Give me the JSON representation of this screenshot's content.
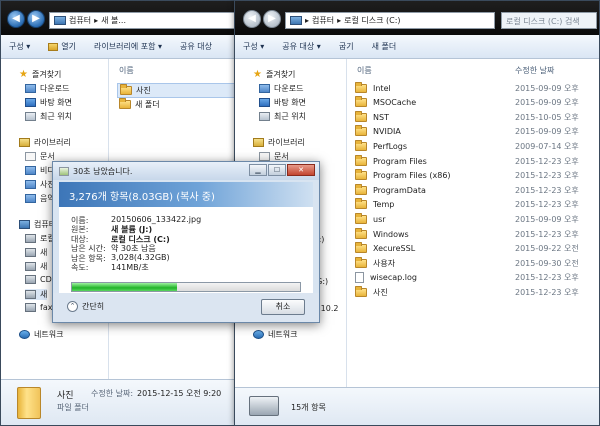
{
  "left_window": {
    "address": [
      "컴퓨터",
      "새 볼..."
    ],
    "toolbar": {
      "organize": "구성 ▾",
      "open": "열기",
      "include_library": "라이브러리에 포함 ▾",
      "share": "공유 대상"
    },
    "nav": {
      "favorites": "즐겨찾기",
      "downloads": "다운로드",
      "desktop": "바탕 화면",
      "recent": "최근 위치",
      "libraries": "라이브러리",
      "lib_docs": "문서",
      "lib_video": "비디",
      "lib_pictures": "사진",
      "lib_music": "음악",
      "computer": "컴퓨터",
      "drive_local": "로컬",
      "drive_new1": "새",
      "drive_new2": "새",
      "drive_cd": "CD",
      "drive_new3": "새",
      "drive_fax": "fax(",
      "network": "네트워크"
    },
    "column_name": "이름",
    "items": [
      "사진",
      "새 폴더"
    ],
    "details": {
      "name": "사진",
      "date_label": "수정한 날짜:",
      "date_value": "2015-12-15 오전 9:20",
      "type": "파일 폴더"
    }
  },
  "right_window": {
    "address": [
      "컴퓨터",
      "로컬 디스크 (C:)"
    ],
    "search_placeholder": "로컬 디스크 (C:) 검색",
    "toolbar": {
      "organize": "구성 ▾",
      "share": "공유 대상 ▾",
      "burn": "굽기",
      "new_folder": "새 폴더"
    },
    "nav": {
      "favorites": "즐겨찾기",
      "downloads": "다운로드",
      "desktop": "바탕 화면",
      "recent": "최근 위치",
      "libraries": "라이브러리",
      "lib_docs": "문서",
      "drive_c": "C:)",
      "drive_g": "(G:)",
      "net_ip": "8.10.2",
      "network": "네트워크"
    },
    "columns": {
      "name": "이름",
      "date": "수정한 날짜"
    },
    "rows": [
      {
        "name": "Intel",
        "date": "2015-09-09 오후",
        "type": "folder"
      },
      {
        "name": "MSOCache",
        "date": "2015-09-09 오후",
        "type": "folder"
      },
      {
        "name": "NST",
        "date": "2015-10-05 오후",
        "type": "folder"
      },
      {
        "name": "NVIDIA",
        "date": "2015-09-09 오후",
        "type": "folder"
      },
      {
        "name": "PerfLogs",
        "date": "2009-07-14 오후",
        "type": "folder"
      },
      {
        "name": "Program Files",
        "date": "2015-12-23 오후",
        "type": "folder"
      },
      {
        "name": "Program Files (x86)",
        "date": "2015-12-23 오후",
        "type": "folder"
      },
      {
        "name": "ProgramData",
        "date": "2015-12-23 오후",
        "type": "folder"
      },
      {
        "name": "Temp",
        "date": "2015-12-23 오후",
        "type": "folder"
      },
      {
        "name": "usr",
        "date": "2015-09-09 오후",
        "type": "folder"
      },
      {
        "name": "Windows",
        "date": "2015-12-23 오후",
        "type": "folder"
      },
      {
        "name": "XecureSSL",
        "date": "2015-09-22 오전",
        "type": "folder"
      },
      {
        "name": "사용자",
        "date": "2015-09-30 오전",
        "type": "folder"
      },
      {
        "name": "wisecap.log",
        "date": "2015-12-23 오후",
        "type": "file"
      },
      {
        "name": "사진",
        "date": "2015-12-23 오후",
        "type": "folder"
      }
    ],
    "status": "15개 항목"
  },
  "copy_dialog": {
    "title": "30초 남았습니다.",
    "headline": "3,276개 항목(8.03GB) (복사 중)",
    "fields": [
      {
        "label": "이름:",
        "value": "20150606_133422.jpg",
        "bold": false
      },
      {
        "label": "원본:",
        "value": "새 볼륨 (J:)",
        "bold": true
      },
      {
        "label": "대상:",
        "value": "로컬 디스크 (C:)",
        "bold": true
      },
      {
        "label": "남은 시간:",
        "value": "약 30초 남음",
        "bold": false
      },
      {
        "label": "남은 항목:",
        "value": "3,028(4.32GB)",
        "bold": false
      },
      {
        "label": "속도:",
        "value": "141MB/초",
        "bold": false
      }
    ],
    "progress_fraction": 0.46,
    "less_label": "간단히",
    "cancel_label": "취소"
  }
}
